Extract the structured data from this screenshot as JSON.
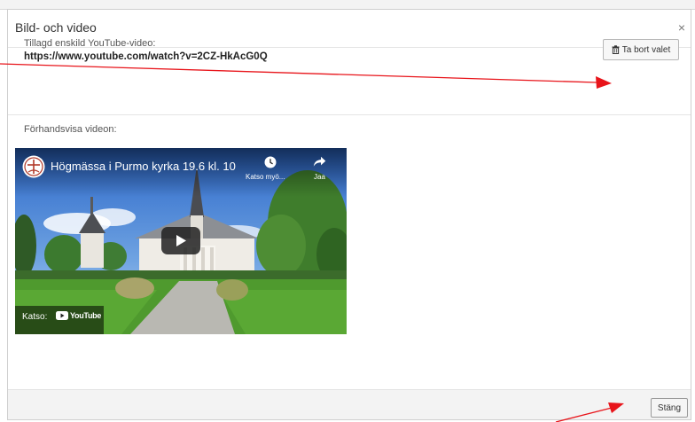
{
  "modal": {
    "title": "Bild- och video",
    "close_glyph": "×"
  },
  "selected": {
    "label": "Tillagd enskild YouTube-video:",
    "url": "https://www.youtube.com/watch?v=2CZ-HkAcG0Q",
    "remove_label": "Ta bort valet"
  },
  "preview": {
    "label": "Förhandsvisa videon:"
  },
  "video": {
    "title": "Högmässa i Purmo kyrka 19.6 kl. 10",
    "watch_later_label": "Katso myö...",
    "share_label": "Jaa",
    "watch_on_label": "Katso:",
    "youtube_label": "YouTube"
  },
  "footer": {
    "close_label": "Stäng"
  },
  "colors": {
    "annotation_arrow": "#e8141a",
    "youtube_red": "#ff0000"
  },
  "icons": [
    "close-icon",
    "trash-icon",
    "play-icon",
    "clock-icon",
    "share-icon",
    "youtube-logo-icon",
    "channel-cross-icon"
  ]
}
